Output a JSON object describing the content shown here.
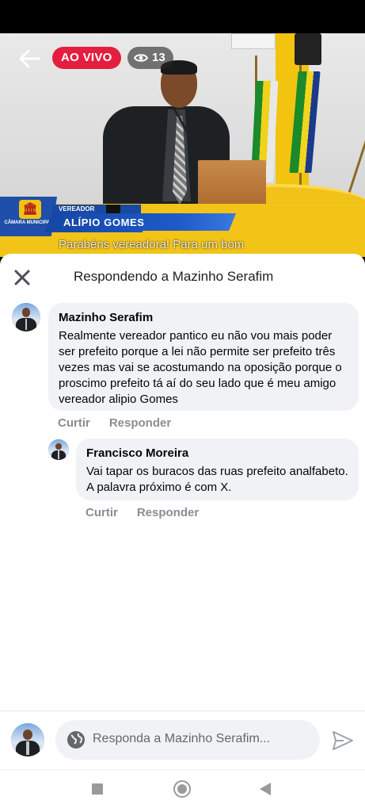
{
  "live": {
    "badge_label": "AO VIVO",
    "viewer_count": "13",
    "lower_third": {
      "logo_text": "CÂMARA MUNICIPAL",
      "role": "VEREADOR",
      "name": "ALÍPIO GOMES"
    },
    "ghost_comment": "Parabéns vereadora! Para um bom"
  },
  "sheet": {
    "title": "Respondendo a Mazinho Serafim"
  },
  "comments": [
    {
      "author": "Mazinho Serafim",
      "text": "Realmente vereador pantico eu não vou mais poder ser prefeito porque a lei não permite ser prefeito três vezes mas vai se acostumando na oposição porque o proscimo prefeito tá aí do seu lado que é meu amigo vereador alipio Gomes",
      "like_label": "Curtir",
      "reply_label": "Responder"
    },
    {
      "author": "Francisco Moreira",
      "text": "Vai tapar os buracos das ruas prefeito analfabeto. A palavra próximo é com X.",
      "like_label": "Curtir",
      "reply_label": "Responder"
    }
  ],
  "composer": {
    "placeholder": "Responda a Mazinho Serafim..."
  },
  "colors": {
    "live_red": "#e41e3f",
    "bubble_bg": "#f0f2f5",
    "muted_text": "#8a8d91",
    "lower_third_blue": "#1546a4",
    "lower_third_yellow": "#f4c316"
  },
  "icons": [
    "back-arrow-icon",
    "eye-icon",
    "close-icon",
    "globe-icon",
    "send-icon",
    "nav-recents-icon",
    "nav-home-icon",
    "nav-back-icon"
  ]
}
